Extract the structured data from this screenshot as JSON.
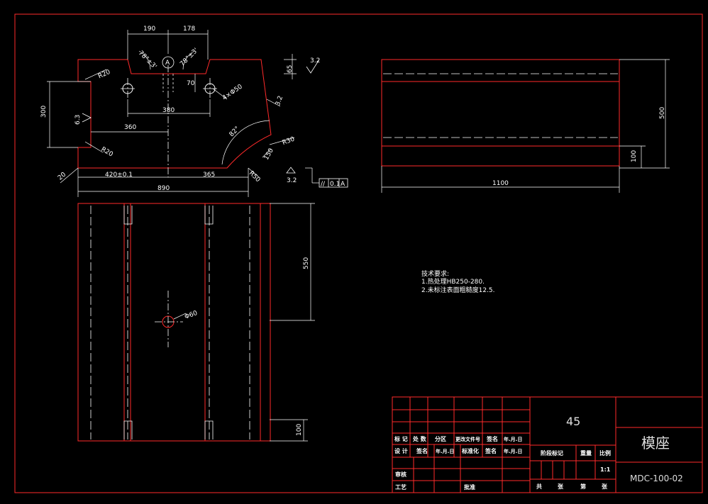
{
  "colors": {
    "outline": "#ff2a2a",
    "dimension": "#ffffff",
    "background": "#000000"
  },
  "views": {
    "front": {
      "dims": {
        "d190": "190",
        "d178": "178",
        "ang1": "78°±3'",
        "ang2": "78°±3'",
        "datum": "A",
        "d65": "65",
        "r32a": "3.2",
        "r20": "R20",
        "d70": "70",
        "d380": "380",
        "holes": "4×Φ50",
        "d300": "300",
        "d63": "6.3",
        "d360": "360",
        "r20b": "R20",
        "d82": "82°",
        "r30": "R30",
        "r32c": "3.2",
        "d150": "150",
        "r50": "R50",
        "d20": "20",
        "d420": "420±0.1",
        "d365": "365",
        "d890": "890",
        "r32d": "3.2",
        "fcf_sym": "//",
        "fcf_val": "0.1",
        "fcf_ref": "A"
      }
    },
    "top": {
      "dims": {
        "d550": "550",
        "phi60": "Φ60",
        "d100": "100"
      }
    },
    "side": {
      "dims": {
        "d500": "500",
        "d100": "100",
        "d1100": "1100"
      }
    }
  },
  "notes": {
    "title": "技术要求:",
    "lines": [
      "1.热处理HB250-280.",
      "2.未标注表面粗糙度12.5."
    ]
  },
  "title_block": {
    "material": "45",
    "part_name": "模座",
    "drawing_no": "MDC-100-02",
    "scale": "1:1",
    "labels": {
      "mark": "标 记",
      "count": "处 数",
      "zone": "分区",
      "change_doc": "更改文件号",
      "sign": "签名",
      "date": "年.月.日",
      "design": "设 计",
      "sign2": "签名",
      "date2": "年.月.日",
      "std": "标准化",
      "sign3": "签名",
      "date3": "年.月.日",
      "stage_mark": "阶段标记",
      "weight": "重量",
      "scale_lbl": "比例",
      "review": "审核",
      "process": "工艺",
      "approve": "批准",
      "total": "共",
      "sheet_unit": "张",
      "sheet": "第",
      "sheet_unit2": "张"
    }
  }
}
